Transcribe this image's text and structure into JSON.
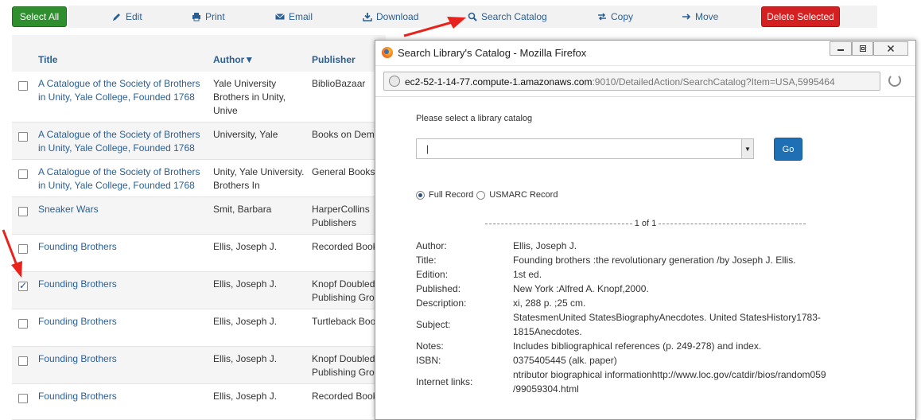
{
  "toolbar": {
    "select_all": "Select All",
    "edit": "Edit",
    "print": "Print",
    "email": "Email",
    "download": "Download",
    "search_catalog": "Search Catalog",
    "copy": "Copy",
    "move": "Move",
    "delete_selected": "Delete Selected"
  },
  "table": {
    "headers": {
      "title": "Title",
      "author": "Author▼",
      "publisher": "Publisher"
    },
    "rows": [
      {
        "title": "A Catalogue of the Society of Brothers in Unity, Yale College, Founded 1768",
        "author": "Yale University Brothers in Unity, Unive",
        "publisher": "BiblioBazaar",
        "checked": false
      },
      {
        "title": "A Catalogue of the Society of Brothers in Unity, Yale College, Founded 1768",
        "author": "University, Yale",
        "publisher": "Books on Dema",
        "checked": false
      },
      {
        "title": "A Catalogue of the Society of Brothers in Unity, Yale College, Founded 1768",
        "author": "Unity, Yale University. Brothers In",
        "publisher": "General Books L",
        "checked": false
      },
      {
        "title": "Sneaker Wars",
        "author": "Smit, Barbara",
        "publisher": "HarperCollins Publishers",
        "checked": false
      },
      {
        "title": "Founding Brothers",
        "author": "Ellis, Joseph J.",
        "publisher": "Recorded Books",
        "checked": false
      },
      {
        "title": "Founding Brothers",
        "author": "Ellis, Joseph J.",
        "publisher": "Knopf Doubleda Publishing Grou",
        "checked": true
      },
      {
        "title": "Founding Brothers",
        "author": "Ellis, Joseph J.",
        "publisher": "Turtleback Book",
        "checked": false
      },
      {
        "title": "Founding Brothers",
        "author": "Ellis, Joseph J.",
        "publisher": "Knopf Doubleda Publishing Grou",
        "checked": false
      },
      {
        "title": "Founding Brothers",
        "author": "Ellis, Joseph J.",
        "publisher": "Recorded Books",
        "checked": false
      }
    ]
  },
  "popup": {
    "window_title": "Search Library's Catalog - Mozilla Firefox",
    "url_host": "ec2-52-1-14-77.compute-1.amazonaws.com",
    "url_rest": ":9010/DetailedAction/SearchCatalog?Item=USA,5995464",
    "select_label": "Please select a library catalog",
    "select_value": "|",
    "go": "Go",
    "full_record": "Full Record",
    "usmarc_record": "USMARC Record",
    "pager": "1 of 1",
    "record": [
      {
        "label": "Author:",
        "value": "Ellis, Joseph J."
      },
      {
        "label": "Title:",
        "value": "Founding brothers :the revolutionary generation /by Joseph J. Ellis."
      },
      {
        "label": "Edition:",
        "value": "1st ed."
      },
      {
        "label": "Published:",
        "value": "New York :Alfred A. Knopf,2000."
      },
      {
        "label": "Description:",
        "value": "xi, 288 p. ;25 cm."
      },
      {
        "label": "Subject:",
        "value": "StatesmenUnited StatesBiographyAnecdotes. United StatesHistory1783-1815Anecdotes."
      },
      {
        "label": "Notes:",
        "value": "Includes bibliographical references (p. 249-278) and index."
      },
      {
        "label": "ISBN:",
        "value": "0375405445 (alk. paper)"
      },
      {
        "label": "Internet links:",
        "value": "ntributor biographical informationhttp://www.loc.gov/catdir/bios/random059 /99059304.html"
      }
    ]
  },
  "colors": {
    "link": "#2a5f94",
    "select_all_bg": "#2f8f2f",
    "delete_bg": "#d42020",
    "go_bg": "#1f6fb4",
    "annotation_arrow": "#e8231e"
  }
}
